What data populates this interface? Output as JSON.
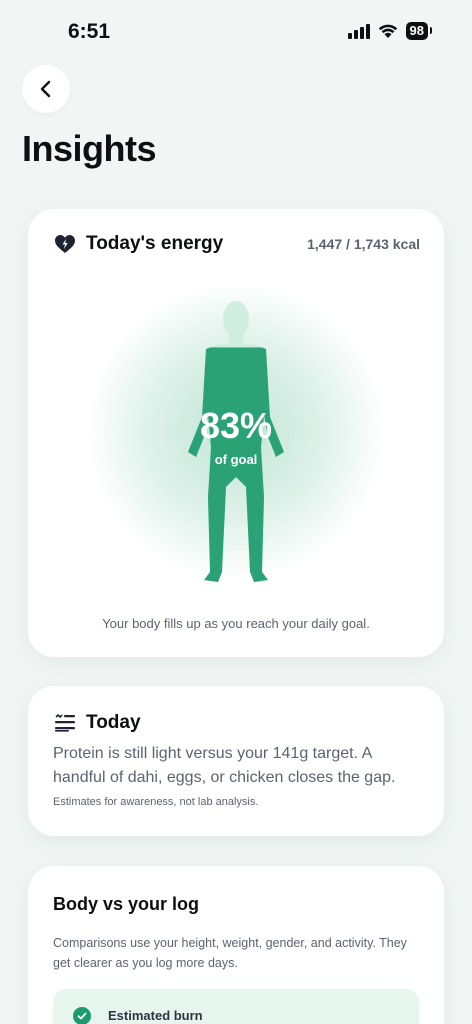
{
  "status_bar": {
    "time": "6:51",
    "battery": "98"
  },
  "header": {
    "back_icon": "chevron-left-icon",
    "title": "Insights"
  },
  "energy_card": {
    "icon": "heart-bolt-icon",
    "title": "Today's energy",
    "kcal": "1,447 / 1,743 kcal",
    "percent": "83%",
    "percent_label": "of goal",
    "fill_fraction": 0.83,
    "caption": "Your body fills up as you reach your daily goal.",
    "accent_color": "#1d9a6c"
  },
  "today_card": {
    "icon": "list-icon",
    "title": "Today",
    "body": "Protein is still light versus your 141g target. A handful of dahi, eggs, or chicken closes the gap.",
    "note": "Estimates for awareness, not lab analysis."
  },
  "body_log_card": {
    "title": "Body vs your log",
    "description": "Comparisons use your height, weight, gender, and activity. They get clearer as you log more days.",
    "burn_icon": "check-circle-icon",
    "burn_label": "Estimated burn"
  }
}
